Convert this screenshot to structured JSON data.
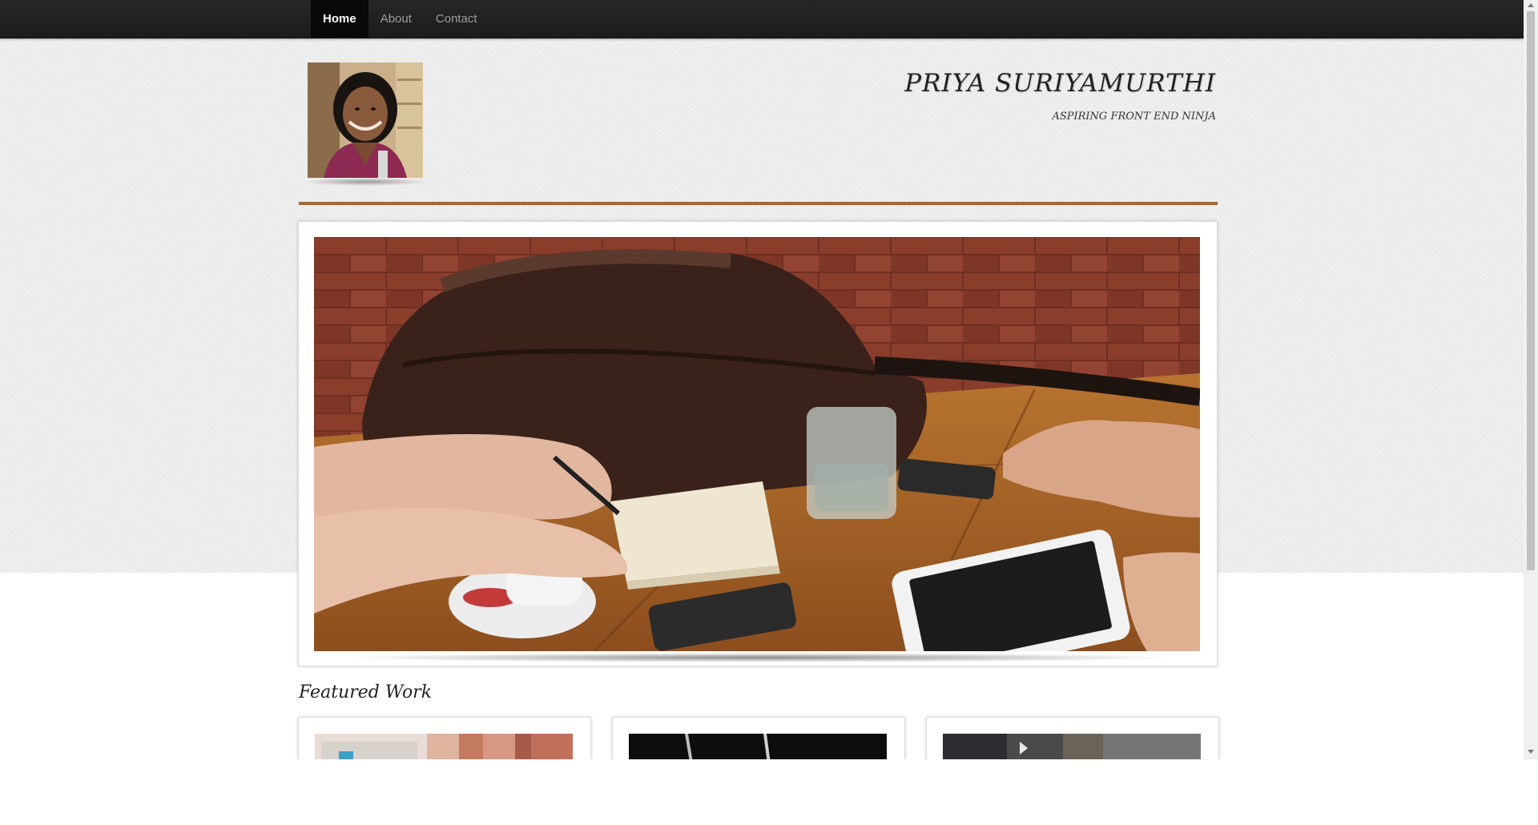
{
  "nav": {
    "items": [
      {
        "label": "Home",
        "active": true
      },
      {
        "label": "About",
        "active": false
      },
      {
        "label": "Contact",
        "active": false
      }
    ]
  },
  "header": {
    "name": "PRIYA SURIYAMURTHI",
    "tagline": "ASPIRING FRONT END NINJA",
    "avatar_icon": "profile-photo",
    "accent_color": "#a0683b"
  },
  "hero": {
    "image": "meeting-table-photo"
  },
  "featured": {
    "heading": "Featured Work",
    "cards": [
      {
        "thumbnail": "laptop-keyboard-photo"
      },
      {
        "thumbnail": "dark-laptop-photo"
      },
      {
        "thumbnail": "office-accessories-photo"
      }
    ]
  },
  "colors": {
    "navbar": "#222222",
    "nav_active": "#080808",
    "nav_text": "#9d9d9d",
    "background": "#ececec"
  }
}
